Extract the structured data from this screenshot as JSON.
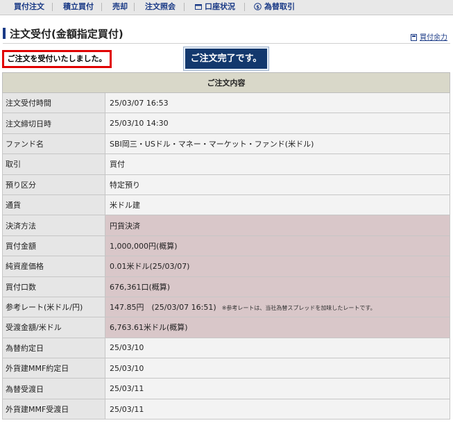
{
  "nav": {
    "items": [
      {
        "label": "買付注文"
      },
      {
        "label": "積立買付"
      },
      {
        "label": "売却"
      },
      {
        "label": "注文照会"
      },
      {
        "label": "口座状況",
        "icon": "account-icon"
      },
      {
        "label": "為替取引",
        "icon": "exchange-icon"
      }
    ]
  },
  "header": {
    "title": "注文受付(金額指定買付)",
    "buy_power_link": "買付余力"
  },
  "messages": {
    "accepted": "ご注文を受付いたしました。",
    "complete": "ご注文完了です。"
  },
  "table": {
    "header": "ご注文内容",
    "rows": [
      {
        "label": "注文受付時間",
        "value": "25/03/07 16:53"
      },
      {
        "label": "注文締切日時",
        "value": "25/03/10 14:30"
      },
      {
        "label": "ファンド名",
        "value": "SBI岡三・USドル・マネー・マーケット・ファンド(米ドル)"
      },
      {
        "label": "取引",
        "value": "買付"
      },
      {
        "label": "預り区分",
        "value": "特定預り"
      },
      {
        "label": "通貨",
        "value": "米ドル建"
      },
      {
        "label": "決済方法",
        "value": "円貨決済"
      },
      {
        "label": "買付金額",
        "value": "1,000,000円(概算)"
      },
      {
        "label": "純資産価格",
        "value": "0.01米ドル(25/03/07)"
      },
      {
        "label": "買付口数",
        "value": "676,361口(概算)"
      },
      {
        "label": "参考レート(米ドル/円)",
        "value": "147.85円　(25/03/07 16:51)",
        "note": "※参考レートは、当社為替スプレッドを加味したレートです。"
      },
      {
        "label": "受渡金額/米ドル",
        "value": "6,763.61米ドル(概算)"
      },
      {
        "label": "為替約定日",
        "value": "25/03/10"
      },
      {
        "label": "外貨建MMF約定日",
        "value": "25/03/10"
      },
      {
        "label": "為替受渡日",
        "value": "25/03/11"
      },
      {
        "label": "外貨建MMF受渡日",
        "value": "25/03/11"
      }
    ]
  },
  "colors": {
    "nav_text": "#1a3a86",
    "complete_bg": "#13386d",
    "alert_border": "#e00000",
    "highlight_row": "#d9c7c9"
  }
}
